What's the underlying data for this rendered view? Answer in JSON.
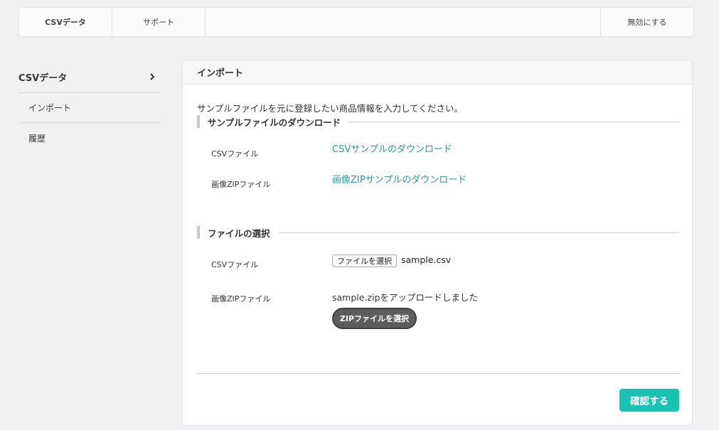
{
  "topbar": {
    "tabs": [
      {
        "label": "CSVデータ"
      },
      {
        "label": "サポート"
      }
    ],
    "disable_label": "無効にする"
  },
  "sidebar": {
    "heading": "CSVデータ",
    "items": [
      {
        "label": "インポート"
      },
      {
        "label": "履歴"
      }
    ]
  },
  "panel": {
    "title": "インポート",
    "intro": "サンプルファイルを元に登録したい商品情報を入力してください。",
    "download_section": {
      "title": "サンプルファイルのダウンロード",
      "rows": [
        {
          "label": "CSVファイル",
          "link": "CSVサンプルのダウンロード"
        },
        {
          "label": "画像ZIPファイル",
          "link": "画像ZIPサンプルのダウンロード"
        }
      ]
    },
    "select_section": {
      "title": "ファイルの選択",
      "csv_label": "CSVファイル",
      "file_button": "ファイルを選択",
      "file_name": "sample.csv",
      "zip_label": "画像ZIPファイル",
      "zip_status": "sample.zipをアップロードしました",
      "zip_button": "ZIPファイルを選択"
    },
    "confirm_label": "確認する"
  }
}
